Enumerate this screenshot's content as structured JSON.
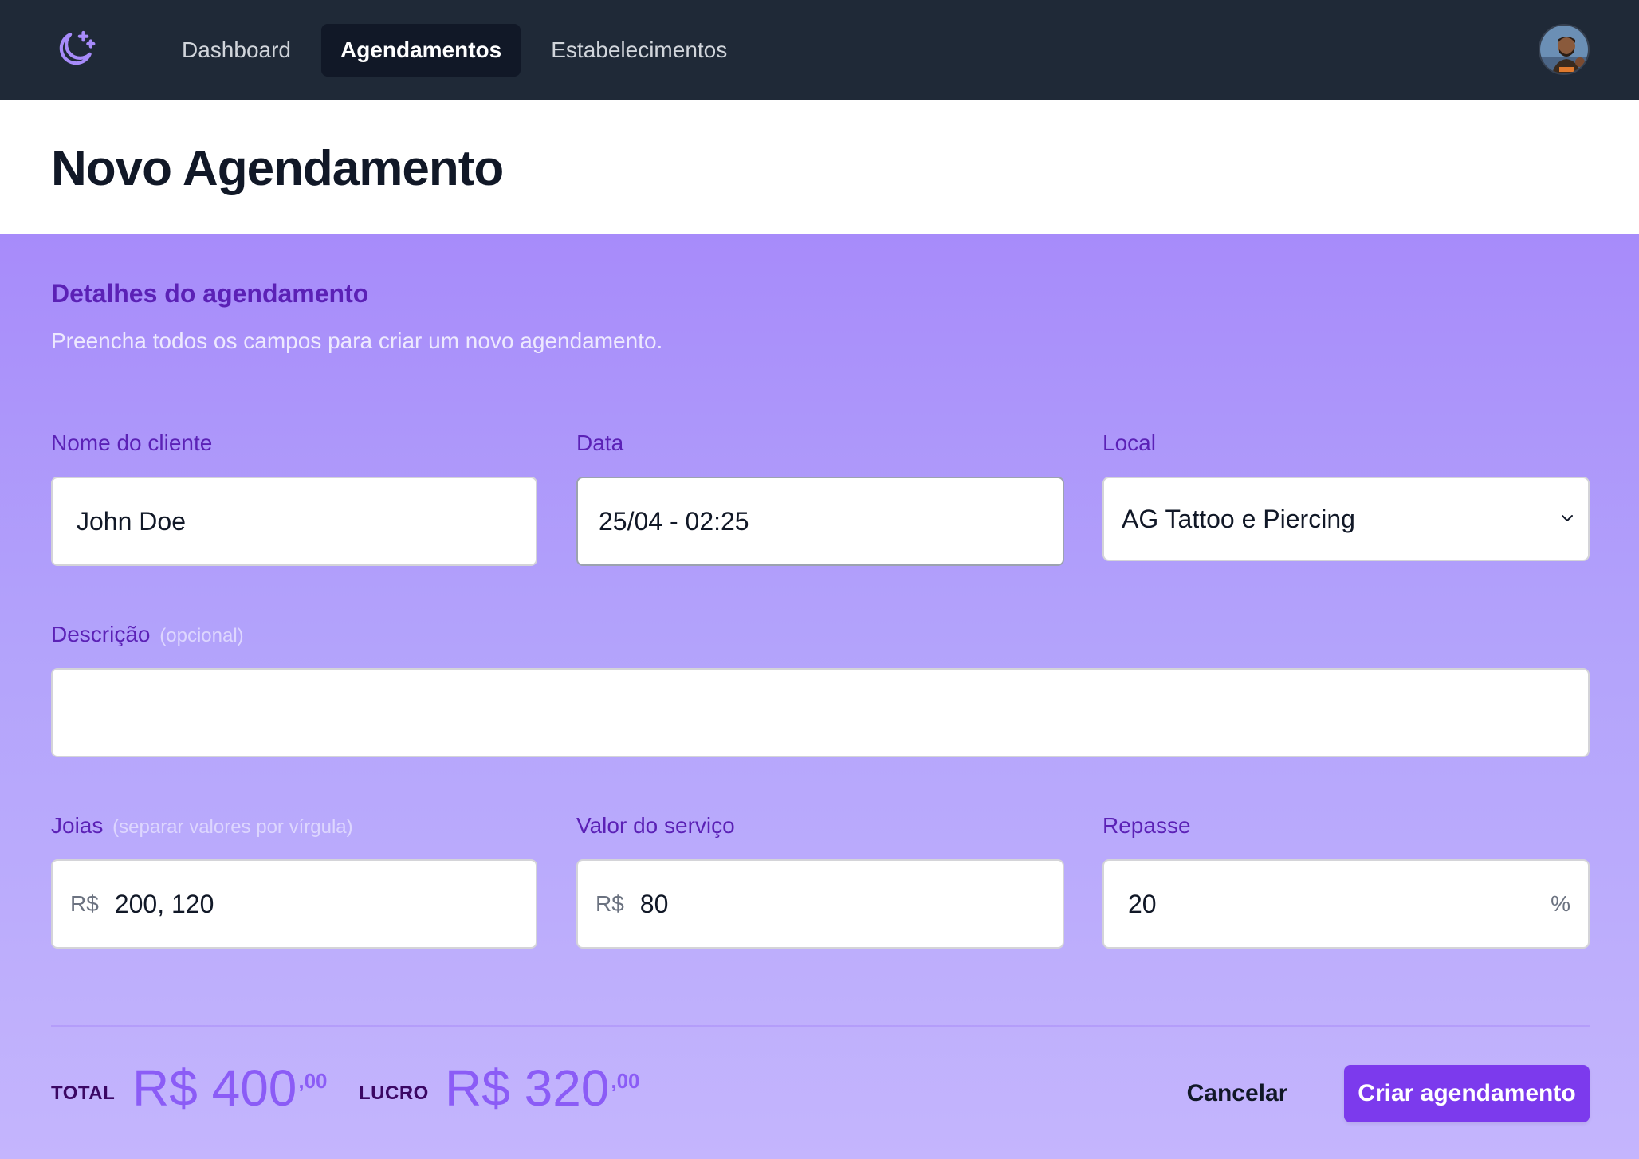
{
  "nav": {
    "items": [
      {
        "label": "Dashboard",
        "active": false
      },
      {
        "label": "Agendamentos",
        "active": true
      },
      {
        "label": "Estabelecimentos",
        "active": false
      }
    ],
    "logo_icon": "moon-stars-icon",
    "avatar_icon": "user-avatar"
  },
  "header": {
    "title": "Novo Agendamento"
  },
  "form": {
    "section_title": "Detalhes do agendamento",
    "section_subtitle": "Preencha todos os campos para criar um novo agendamento.",
    "client": {
      "label": "Nome do cliente",
      "value": "John Doe"
    },
    "date": {
      "label": "Data",
      "value": "25/04 - 02:25"
    },
    "location": {
      "label": "Local",
      "value": "AG Tattoo e Piercing"
    },
    "description": {
      "label": "Descrição",
      "hint": "(opcional)",
      "value": ""
    },
    "jewels": {
      "label": "Joias",
      "hint": "(separar valores por vírgula)",
      "prefix": "R$",
      "value": "200, 120"
    },
    "service_value": {
      "label": "Valor do serviço",
      "prefix": "R$",
      "value": "80"
    },
    "repasse": {
      "label": "Repasse",
      "suffix": "%",
      "value": "20"
    }
  },
  "summary": {
    "total_label": "TOTAL",
    "total_value": "R$ 400",
    "total_cents": ",00",
    "profit_label": "LUCRO",
    "profit_value": "R$ 320",
    "profit_cents": ",00"
  },
  "actions": {
    "cancel_label": "Cancelar",
    "submit_label": "Criar agendamento"
  },
  "colors": {
    "nav_bg": "#1f2937",
    "accent": "#7c3aed",
    "label": "#5b21b6",
    "form_bg_top": "#a78bfa",
    "form_bg_bottom": "#c4b5fd"
  }
}
